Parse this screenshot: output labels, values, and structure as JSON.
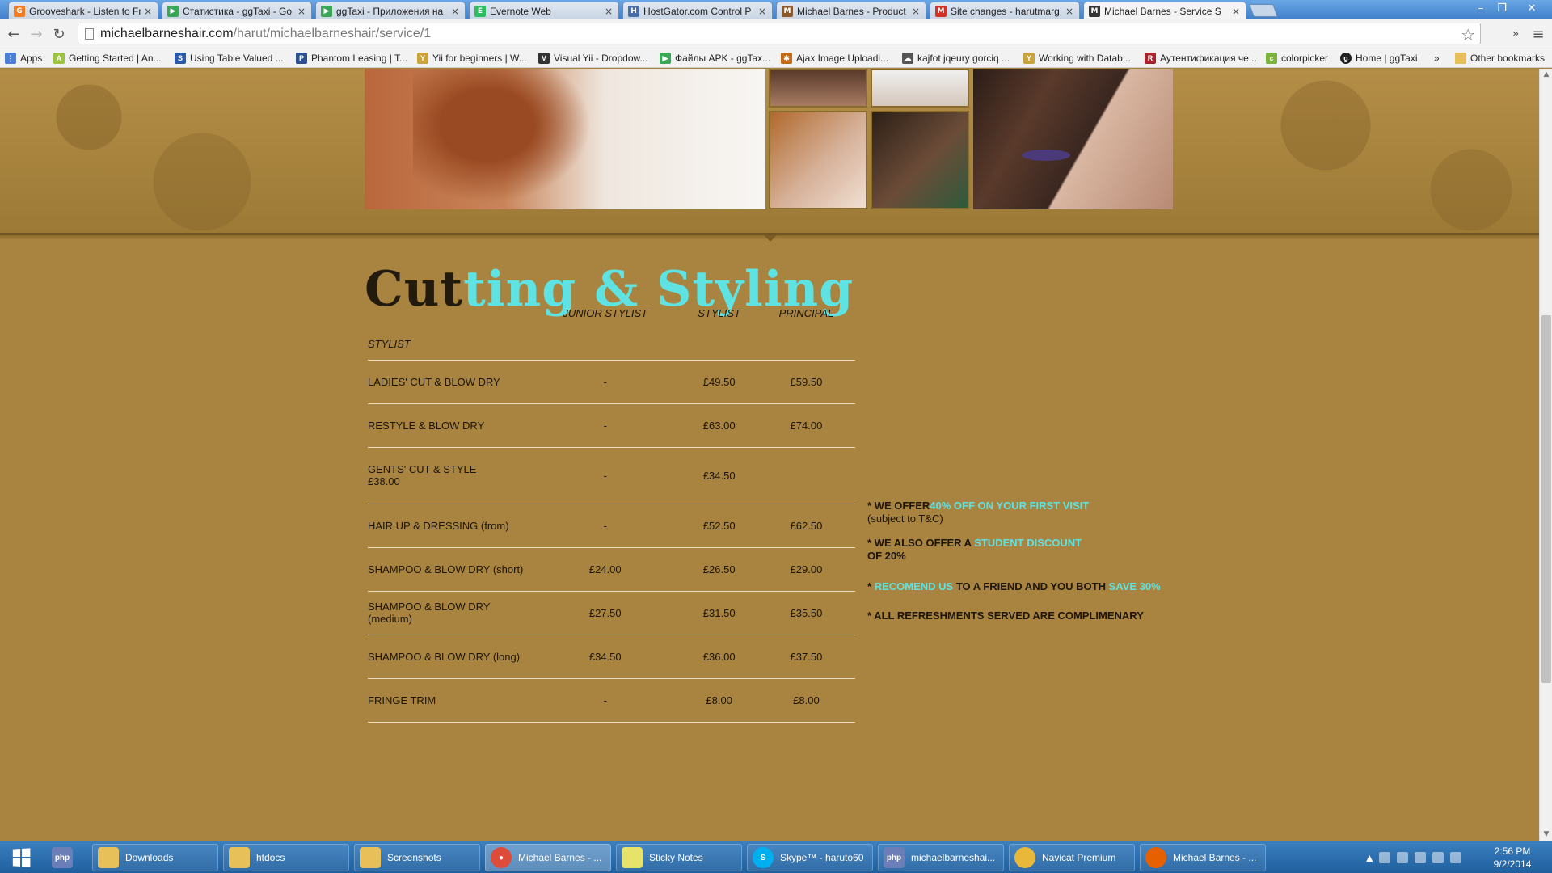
{
  "browser": {
    "tabs": [
      {
        "title": "Grooveshark - Listen to Fr",
        "icon": "grooveshark-icon",
        "color": "#f47b20"
      },
      {
        "title": "Статистика - ggTaxi - Go",
        "icon": "google-play-icon",
        "color": "#3aa757"
      },
      {
        "title": "ggTaxi - Приложения на",
        "icon": "google-play-icon",
        "color": "#3aa757"
      },
      {
        "title": "Evernote Web",
        "icon": "evernote-icon",
        "color": "#2dbe60"
      },
      {
        "title": "HostGator.com Control P",
        "icon": "hostgator-icon",
        "color": "#4a6ea9"
      },
      {
        "title": "Michael Barnes - Product",
        "icon": "mb-icon",
        "color": "#8a5a2a"
      },
      {
        "title": "Site changes - harutmarg",
        "icon": "gmail-icon",
        "color": "#d93025"
      },
      {
        "title": "Michael Barnes - Service S",
        "icon": "mb-icon",
        "color": "#333333",
        "active": true
      }
    ],
    "url_host": "michaelbarneshair.com",
    "url_path": "/harut/michaelbarneshair/service/1",
    "bookmarks": [
      {
        "label": "Apps",
        "icon": "apps-grid-icon"
      },
      {
        "label": "Getting Started | An...",
        "icon": "android-icon"
      },
      {
        "label": "Using Table Valued ...",
        "icon": "sql-icon"
      },
      {
        "label": "Phantom Leasing | T...",
        "icon": "phantom-icon"
      },
      {
        "label": "Yii for beginners | W...",
        "icon": "yii-icon"
      },
      {
        "label": "Visual Yii - Dropdow...",
        "icon": "visual-yii-icon"
      },
      {
        "label": "Файлы APK - ggTax...",
        "icon": "google-play-icon"
      },
      {
        "label": "Ajax Image Uploadi...",
        "icon": "ajax-icon"
      },
      {
        "label": "kajfot jqeury gorciq ...",
        "icon": "cloud-icon"
      },
      {
        "label": "Working with Datab...",
        "icon": "yii-icon"
      },
      {
        "label": "Аутентификация че...",
        "icon": "r-icon"
      },
      {
        "label": "colorpicker",
        "icon": "colorpicker-icon"
      },
      {
        "label": "Home | ggTaxi",
        "icon": "ggtaxi-icon"
      },
      {
        "label": "»",
        "icon": ""
      },
      {
        "label": "Other bookmarks",
        "icon": "folder-icon"
      }
    ]
  },
  "page": {
    "title_dark": "Cut",
    "title_light": "ting & Styling",
    "table": {
      "headers": [
        "STYLIST",
        "JUNIOR STYLIST",
        "STYLIST",
        "PRINCIPAL"
      ],
      "rows": [
        {
          "name": "LADIES' CUT & BLOW DRY",
          "junior": "-",
          "stylist": "£49.50",
          "principal": "£59.50"
        },
        {
          "name": "RESTYLE & BLOW DRY",
          "junior": "-",
          "stylist": "£63.00",
          "principal": "£74.00"
        },
        {
          "name": "GENTS' CUT & STYLE",
          "name2": "£38.00",
          "junior": "-",
          "stylist": "£34.50",
          "principal": ""
        },
        {
          "name": "HAIR UP & DRESSING (from)",
          "junior": "-",
          "stylist": "£52.50",
          "principal": "£62.50"
        },
        {
          "name": "SHAMPOO & BLOW DRY (short)",
          "junior": "£24.00",
          "stylist": "£26.50",
          "principal": "£29.00"
        },
        {
          "name": "SHAMPOO & BLOW DRY (medium)",
          "junior": "£27.50",
          "stylist": "£31.50",
          "principal": "£35.50"
        },
        {
          "name": "SHAMPOO & BLOW DRY (long)",
          "junior": "£34.50",
          "stylist": "£36.00",
          "principal": "£37.50"
        },
        {
          "name": "FRINGE TRIM",
          "junior": "-",
          "stylist": "£8.00",
          "principal": "£8.00"
        }
      ]
    },
    "offers": {
      "o1_pre": "* WE OFFER",
      "o1_hl": "40% OFF ON YOUR FIRST VISIT",
      "o1_sub": "(subject to T&C)",
      "o2_pre": "* WE ALSO OFFER A",
      "o2_hl": "STUDENT DISCOUNT",
      "o2_post": "OF 20%",
      "o3_pre": "*",
      "o3_hl1": "RECOMEND US",
      "o3_mid": "TO A FRIEND AND YOU BOTH",
      "o3_hl2": "SAVE 30%",
      "o4": "* ALL REFRESHMENTS SERVED ARE COMPLIMENARY"
    },
    "colors": {
      "accent": "#5fe2e2",
      "background": "#a88440",
      "text": "#1d1509"
    }
  },
  "taskbar": {
    "apps": [
      {
        "label": "",
        "icon": "php-icon",
        "color": "#6b7eb8"
      },
      {
        "label": "Downloads",
        "icon": "folder-icon",
        "color": "#e8c05a"
      },
      {
        "label": "htdocs",
        "icon": "folder-icon",
        "color": "#e8c05a"
      },
      {
        "label": "Screenshots",
        "icon": "folder-icon",
        "color": "#e8c05a"
      },
      {
        "label": "Michael Barnes - ...",
        "icon": "chrome-icon",
        "color": "#dd4b39",
        "active": true
      },
      {
        "label": "Sticky Notes",
        "icon": "sticky-notes-icon",
        "color": "#e6e26a"
      },
      {
        "label": "Skype™ - haruto60",
        "icon": "skype-icon",
        "color": "#00aff0"
      },
      {
        "label": "michaelbarneshai...",
        "icon": "php-icon",
        "color": "#6b7eb8"
      },
      {
        "label": "Navicat Premium",
        "icon": "navicat-icon",
        "color": "#e9b83a"
      },
      {
        "label": "Michael Barnes - ...",
        "icon": "firefox-icon",
        "color": "#e66000"
      }
    ],
    "time": "2:56 PM",
    "date": "9/2/2014"
  }
}
